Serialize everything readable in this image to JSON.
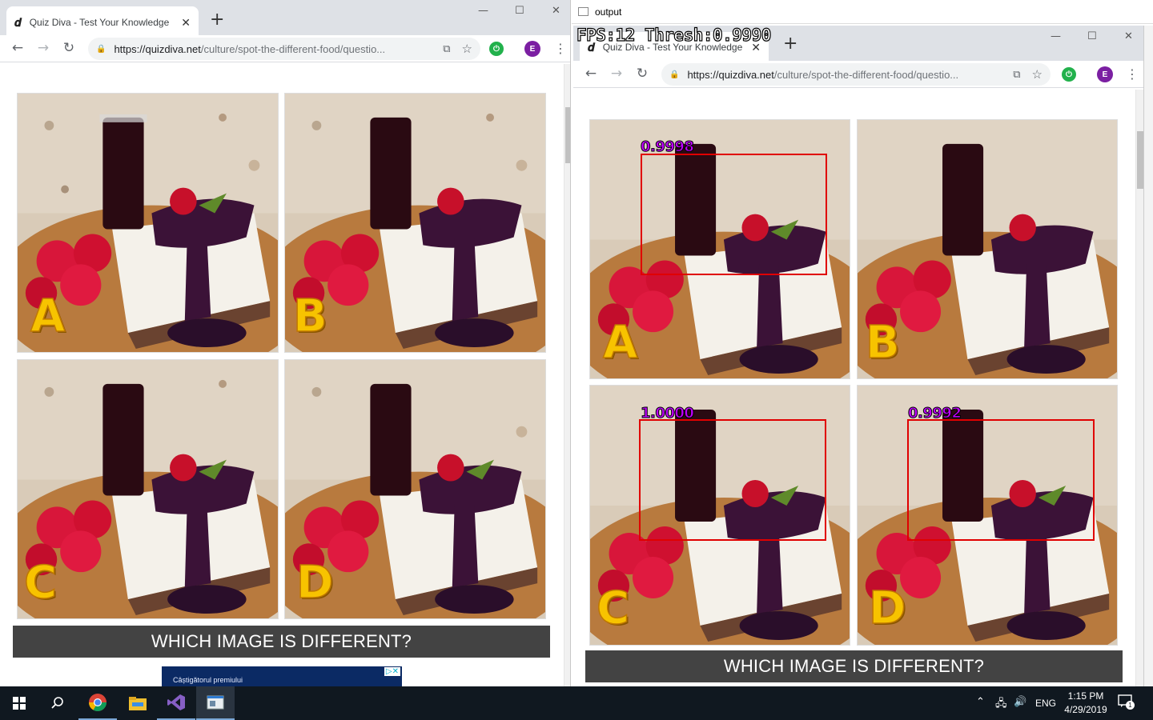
{
  "left_browser": {
    "tab_title": "Quiz Diva - Test Your Knowledge",
    "tab_close": "✕",
    "new_tab": "+",
    "url_domain": "https://quizdiva.net",
    "url_path": "/culture/spot-the-different-food/questio...",
    "profile_initial": "E",
    "question_banner": "WHICH IMAGE IS DIFFERENT?",
    "ad_text": "Câștigătorul premiului"
  },
  "quiz_options": [
    {
      "letter": "A"
    },
    {
      "letter": "B"
    },
    {
      "letter": "C"
    },
    {
      "letter": "D"
    }
  ],
  "output_window": {
    "title": "output",
    "overlay_status": "FPS:12 Thresh:0.9990",
    "tab_title": "Quiz Diva - Test Your Knowledge",
    "url_domain": "https://quizdiva.net",
    "url_path": "/culture/spot-the-different-food/questio...",
    "profile_initial": "E",
    "question_banner": "WHICH IMAGE IS DIFFERENT?",
    "detections": [
      {
        "tile": "A",
        "score": "0.9998"
      },
      {
        "tile": "C",
        "score": "1.0000"
      },
      {
        "tile": "D",
        "score": "0.9992"
      }
    ]
  },
  "taskbar": {
    "language": "ENG",
    "time": "1:15 PM",
    "date": "4/29/2019",
    "notification_count": "1",
    "pinned_apps": [
      "windows-start-icon",
      "search-icon",
      "chrome-icon",
      "file-explorer-icon",
      "visual-studio-icon",
      "output-app-icon"
    ]
  },
  "colors": {
    "accent_profile": "#7b1fa2",
    "detection_box": "#e00000",
    "score_text": "#c000ff",
    "banner_bg": "#434343",
    "taskbar_bg": "#101820"
  }
}
